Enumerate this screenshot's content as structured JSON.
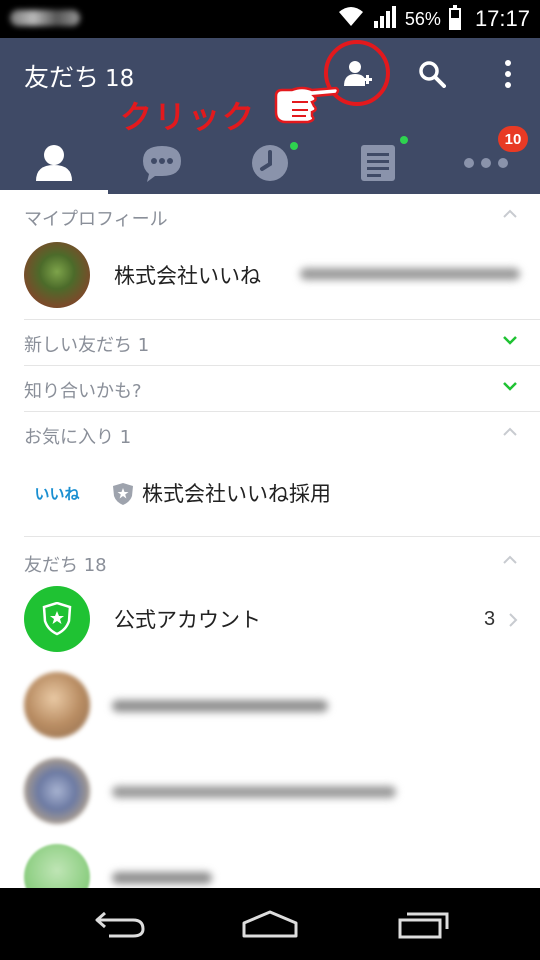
{
  "status_bar": {
    "battery_percent_text": "56%",
    "battery_level": 0.56,
    "time": "17:17"
  },
  "header": {
    "title": "友だち",
    "title_count": "18",
    "annotation_text": "クリック"
  },
  "tabs": [
    {
      "name": "friends",
      "icon": "person-icon",
      "active": true
    },
    {
      "name": "chats",
      "icon": "chat-bubble-icon",
      "active": false
    },
    {
      "name": "timeline",
      "icon": "clock-icon",
      "active": false,
      "new_dot": true
    },
    {
      "name": "news",
      "icon": "document-icon",
      "active": false,
      "new_dot": true
    },
    {
      "name": "more",
      "icon": "dots-icon",
      "active": false,
      "badge": "10"
    }
  ],
  "sections": {
    "my_profile": {
      "label": "マイプロフィール",
      "name": "株式会社いいね"
    },
    "new_friends": {
      "label": "新しい友だち 1"
    },
    "might_know": {
      "label": "知り合いかも?"
    },
    "favorites": {
      "label": "お気に入り 1",
      "item_name": "株式会社いいね採用",
      "logo_text": "いいね"
    },
    "friends": {
      "label": "友だち 18",
      "official_label": "公式アカウント",
      "official_count": "3"
    }
  },
  "colors": {
    "header_bg": "#3f4a66",
    "accent_green": "#1fc233",
    "annotation_red": "#e3191d",
    "badge_red": "#e83a24"
  }
}
